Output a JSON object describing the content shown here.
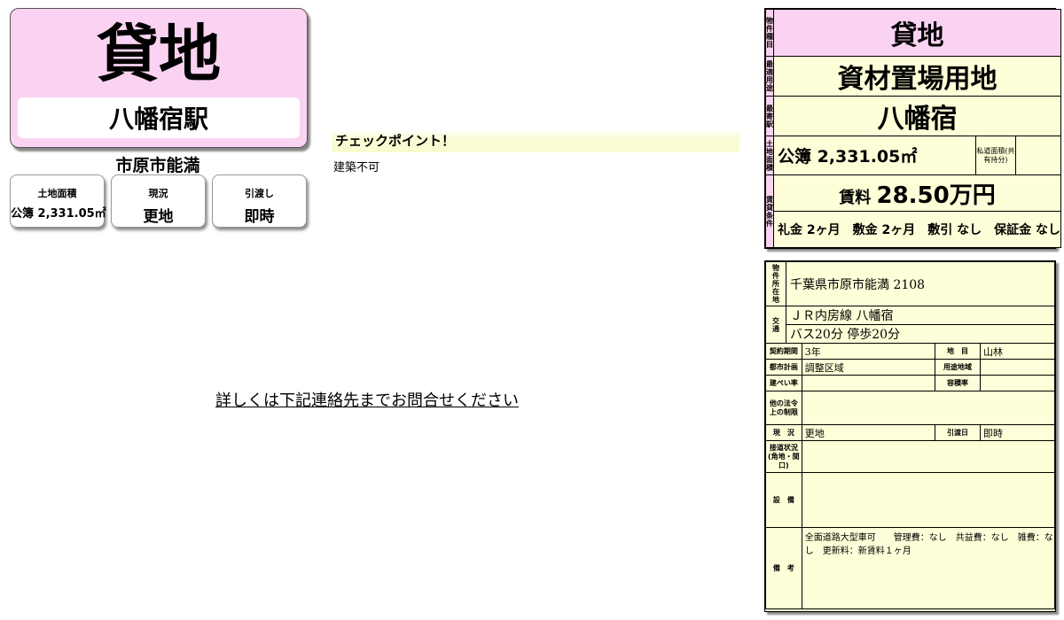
{
  "title_card": {
    "type": "貸地",
    "station": "八幡宿駅"
  },
  "location": "市原市能満",
  "info_boxes": [
    {
      "label": "土地面積",
      "value": "公簿 2,331.05㎡"
    },
    {
      "label": "現況",
      "value": "更地"
    },
    {
      "label": "引渡し",
      "value": "即時"
    }
  ],
  "checkpoint": {
    "title": "チェックポイント！",
    "text": "建築不可"
  },
  "contact": "詳しくは下記連絡先までお問合せください",
  "summary": {
    "type_label": "物件種目",
    "type_value": "貸地",
    "use_label": "最適用途",
    "use_value": "資材置場用地",
    "station_label": "最寄駅",
    "station_value": "八幡宿",
    "area_label": "土地面積",
    "area_value": "公簿 2,331.05㎡",
    "private_road_label": "私道面積(共有持分)",
    "rent_label": "賃貸条件",
    "rent_prefix": "賃料",
    "rent_value": "28.50万円",
    "fees": "礼金 2ヶ月　敷金 2ヶ月　敷引 なし　保証金 なし"
  },
  "details": {
    "address_label": "物件所在地",
    "address": "千葉県市原市能満 2108",
    "transport_label": "交通",
    "line": "ＪＲ内房線 八幡宿",
    "bus": "バス20分 停歩20分",
    "contract_label": "契約期間",
    "contract": "3年",
    "chimoku_label": "地　目",
    "chimoku": "山林",
    "city_plan_label": "都市計画",
    "city_plan": "調整区域",
    "zone_label": "用途地域",
    "zone": "",
    "bcr_label": "建ぺい率",
    "bcr": "",
    "far_label": "容積率",
    "far": "",
    "legal_label": "他の法令上の制限",
    "legal": "",
    "status_label": "現　況",
    "status": "更地",
    "handover_label": "引渡日",
    "handover": "即時",
    "road_label": "接道状況",
    "road_sub": "(角地・間口)",
    "road": "",
    "equip_label": "設　備",
    "equip": "",
    "remarks_label": "備　考",
    "remarks": "全面道路大型車可　　管理費：なし　共益費：なし　雑費：なし　更新料：新賃料１ヶ月"
  },
  "colors": {
    "pink": "#fbd3f2",
    "yellow": "#fefed8"
  }
}
